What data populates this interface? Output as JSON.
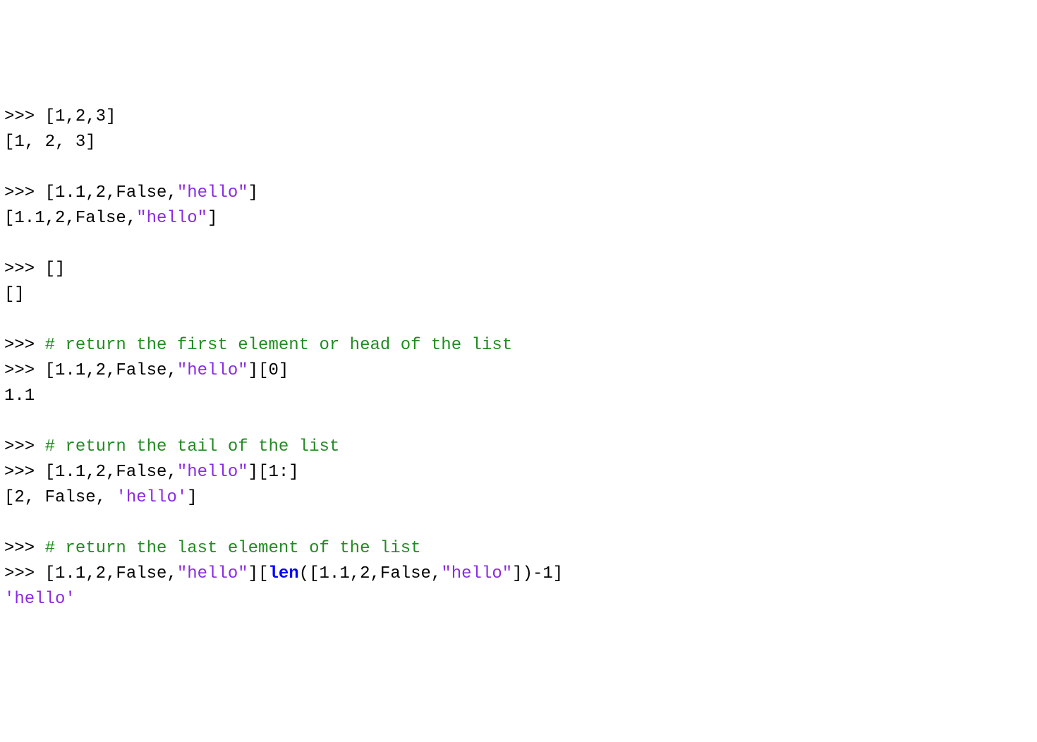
{
  "lines": [
    {
      "segments": [
        {
          "text": ">>> [1,2,3]",
          "class": "black"
        }
      ]
    },
    {
      "segments": [
        {
          "text": "[1, 2, 3]",
          "class": "black"
        }
      ]
    },
    {
      "segments": [
        {
          "text": " ",
          "class": "black"
        }
      ]
    },
    {
      "segments": [
        {
          "text": ">>> [1.1,2,False,",
          "class": "black"
        },
        {
          "text": "\"hello\"",
          "class": "purple"
        },
        {
          "text": "]",
          "class": "black"
        }
      ]
    },
    {
      "segments": [
        {
          "text": "[1.1,2,False,",
          "class": "black"
        },
        {
          "text": "\"hello\"",
          "class": "purple"
        },
        {
          "text": "]",
          "class": "black"
        }
      ]
    },
    {
      "segments": [
        {
          "text": " ",
          "class": "black"
        }
      ]
    },
    {
      "segments": [
        {
          "text": ">>> []",
          "class": "black"
        }
      ]
    },
    {
      "segments": [
        {
          "text": "[]",
          "class": "black"
        }
      ]
    },
    {
      "segments": [
        {
          "text": " ",
          "class": "black"
        }
      ]
    },
    {
      "segments": [
        {
          "text": ">>> ",
          "class": "black"
        },
        {
          "text": "# return the first element or head of the list",
          "class": "green"
        }
      ]
    },
    {
      "segments": [
        {
          "text": ">>> [1.1,2,False,",
          "class": "black"
        },
        {
          "text": "\"hello\"",
          "class": "purple"
        },
        {
          "text": "][0]",
          "class": "black"
        }
      ]
    },
    {
      "segments": [
        {
          "text": "1.1",
          "class": "black"
        }
      ]
    },
    {
      "segments": [
        {
          "text": " ",
          "class": "black"
        }
      ]
    },
    {
      "segments": [
        {
          "text": ">>> ",
          "class": "black"
        },
        {
          "text": "# return the tail of the list",
          "class": "green"
        }
      ]
    },
    {
      "segments": [
        {
          "text": ">>> [1.1,2,False,",
          "class": "black"
        },
        {
          "text": "\"hello\"",
          "class": "purple"
        },
        {
          "text": "][1:]",
          "class": "black"
        }
      ]
    },
    {
      "segments": [
        {
          "text": "[2, False, ",
          "class": "black"
        },
        {
          "text": "'hello'",
          "class": "purple"
        },
        {
          "text": "]",
          "class": "black"
        }
      ]
    },
    {
      "segments": [
        {
          "text": " ",
          "class": "black"
        }
      ]
    },
    {
      "segments": [
        {
          "text": ">>> ",
          "class": "black"
        },
        {
          "text": "# return the last element of the list",
          "class": "green"
        }
      ]
    },
    {
      "segments": [
        {
          "text": ">>> [1.1,2,False,",
          "class": "black"
        },
        {
          "text": "\"hello\"",
          "class": "purple"
        },
        {
          "text": "][",
          "class": "black"
        },
        {
          "text": "len",
          "class": "blue"
        },
        {
          "text": "([1.1,2,False,",
          "class": "black"
        },
        {
          "text": "\"hello\"",
          "class": "purple"
        },
        {
          "text": "])-1]",
          "class": "black"
        }
      ]
    },
    {
      "segments": [
        {
          "text": "'hello'",
          "class": "purple"
        }
      ]
    }
  ]
}
